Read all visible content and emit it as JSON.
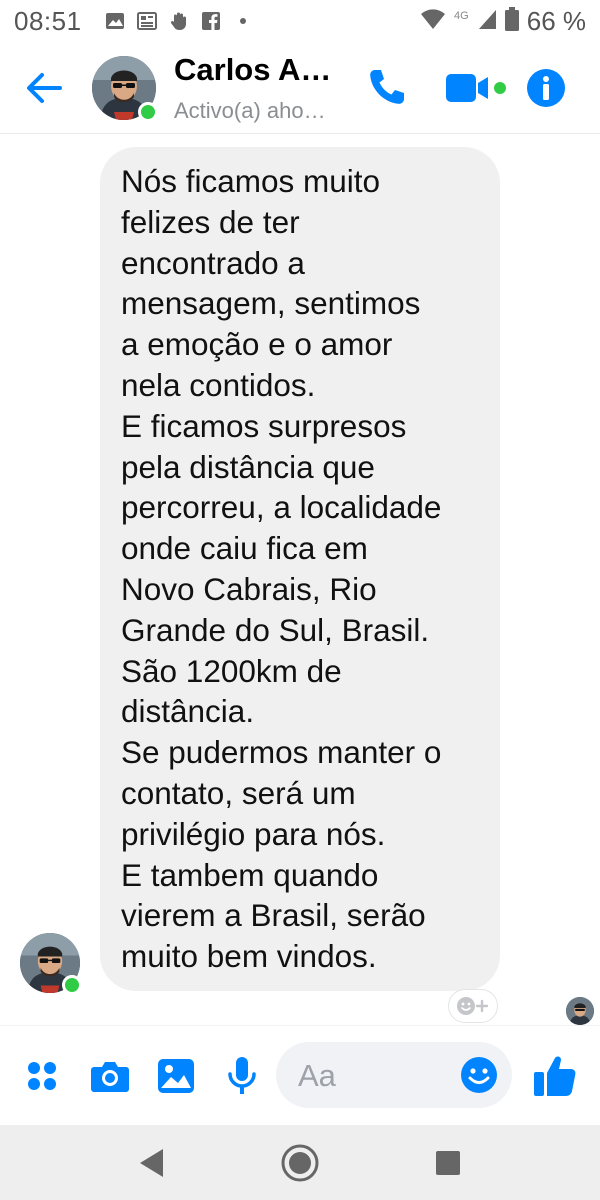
{
  "status_bar": {
    "time": "08:51",
    "network": "4G",
    "battery_percent": "66 %",
    "notification_icons": [
      "gallery-icon",
      "news-icon",
      "hand-icon",
      "facebook-icon",
      "dot-icon"
    ]
  },
  "header": {
    "contact_name": "Carlos A…",
    "contact_status": "Activo(a) aho…",
    "back_icon": "arrow-left-icon",
    "call_icon": "phone-icon",
    "video_icon": "video-camera-icon",
    "info_icon": "info-icon",
    "online": true
  },
  "conversation": {
    "messages": [
      {
        "sender": "Carlos A…",
        "direction": "incoming",
        "text": "Nós ficamos muito\nfelizes de ter\nencontrado a\nmensagem, sentimos\na emoção e o amor\nnela contidos.\nE ficamos surpresos\npela distância que\npercorreu, a localidade\nonde caiu fica em\nNovo Cabrais, Rio\nGrande do Sul, Brasil.\nSão 1200km de\ndistância.\nSe pudermos manter o\ncontato, será um\nprivilégio para nós.\nE tambem quando\nvierem a Brasil, serão\nmuito bem vindos."
      }
    ],
    "reaction_button": "☺+"
  },
  "composer": {
    "placeholder": "Aa",
    "icons": [
      "menu-dots-icon",
      "camera-icon",
      "image-icon",
      "microphone-icon",
      "emoji-icon",
      "thumbs-up-icon"
    ]
  },
  "colors": {
    "accent": "#0084ff",
    "online_green": "#31cc46",
    "bubble_bg": "#f0f0f0",
    "input_bg": "#f1f2f6",
    "navbar_bg": "#eeeeee"
  }
}
